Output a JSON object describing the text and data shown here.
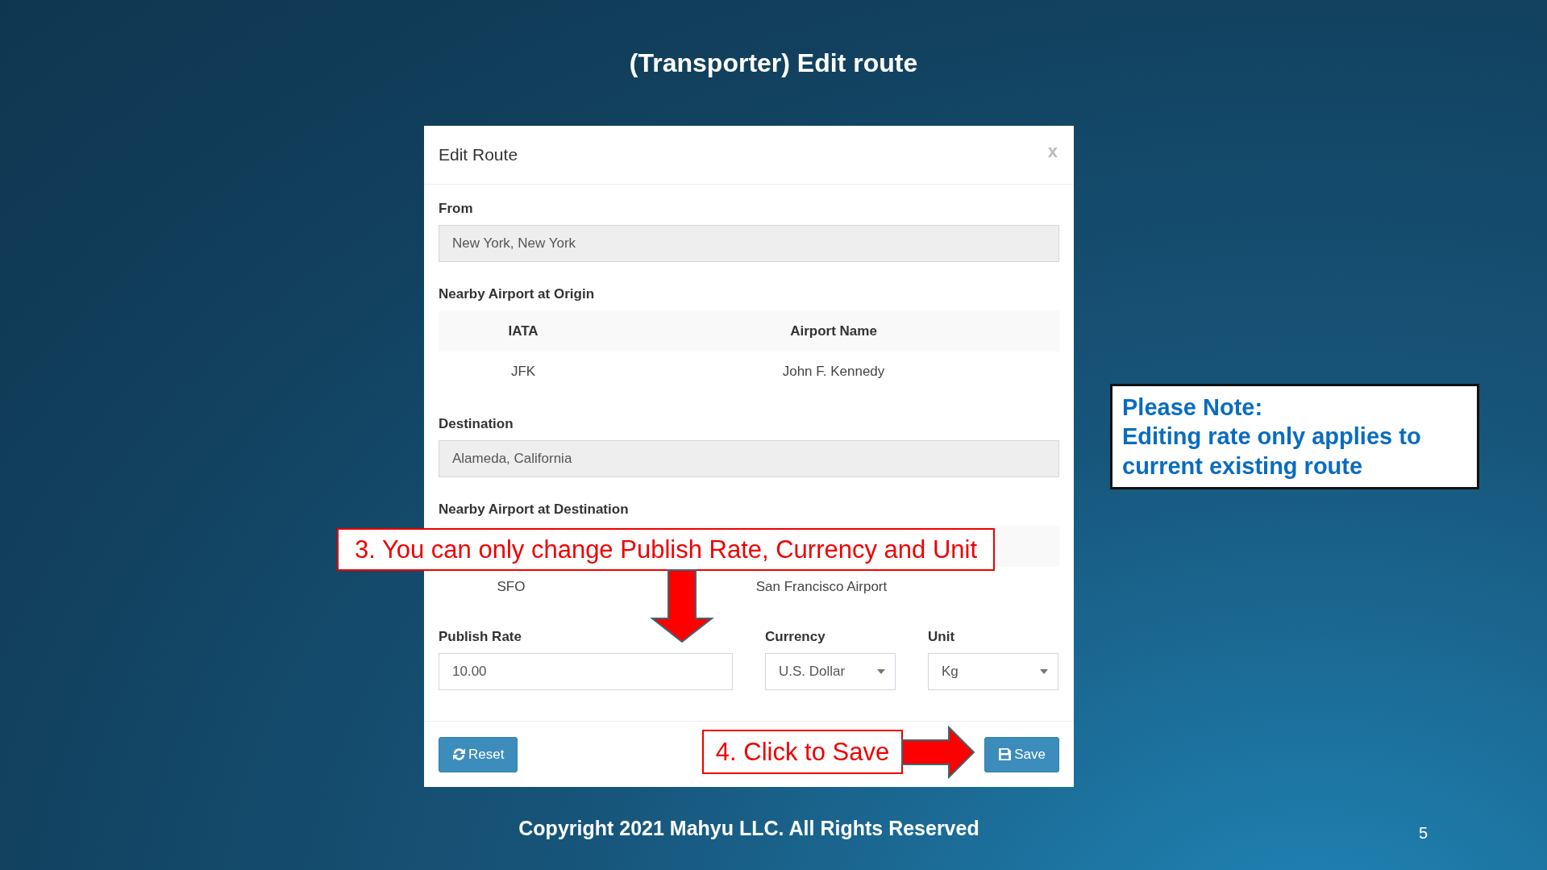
{
  "slide": {
    "title": "(Transporter) Edit route",
    "copyright": "Copyright 2021 Mahyu LLC. All Rights Reserved",
    "page_number": "5"
  },
  "dialog": {
    "title": "Edit Route",
    "close": "x",
    "from": {
      "label": "From",
      "value": "New York, New York"
    },
    "origin_airports": {
      "label": "Nearby Airport at Origin",
      "columns": [
        "IATA",
        "Airport Name"
      ],
      "rows": [
        [
          "JFK",
          "John F. Kennedy"
        ]
      ]
    },
    "destination": {
      "label": "Destination",
      "value": "Alameda, California"
    },
    "destination_airports": {
      "label": "Nearby Airport at Destination",
      "rows": [
        [
          "SFO",
          "San Francisco Airport"
        ]
      ]
    },
    "publish_rate": {
      "label": "Publish Rate",
      "value": "10.00"
    },
    "currency": {
      "label": "Currency",
      "value": "U.S. Dollar"
    },
    "unit": {
      "label": "Unit",
      "value": "Kg"
    },
    "buttons": [
      {
        "label": "Reset",
        "kind": "reset"
      },
      {
        "label": "Save",
        "kind": "save"
      }
    ]
  },
  "annotations": [
    {
      "text": "3. You can only change Publish Rate, Currency and Unit",
      "kind": "down"
    },
    {
      "text": "4. Click to Save",
      "kind": "right"
    }
  ],
  "note": {
    "title": "Please Note:",
    "text": "Editing rate only applies to current existing route"
  }
}
